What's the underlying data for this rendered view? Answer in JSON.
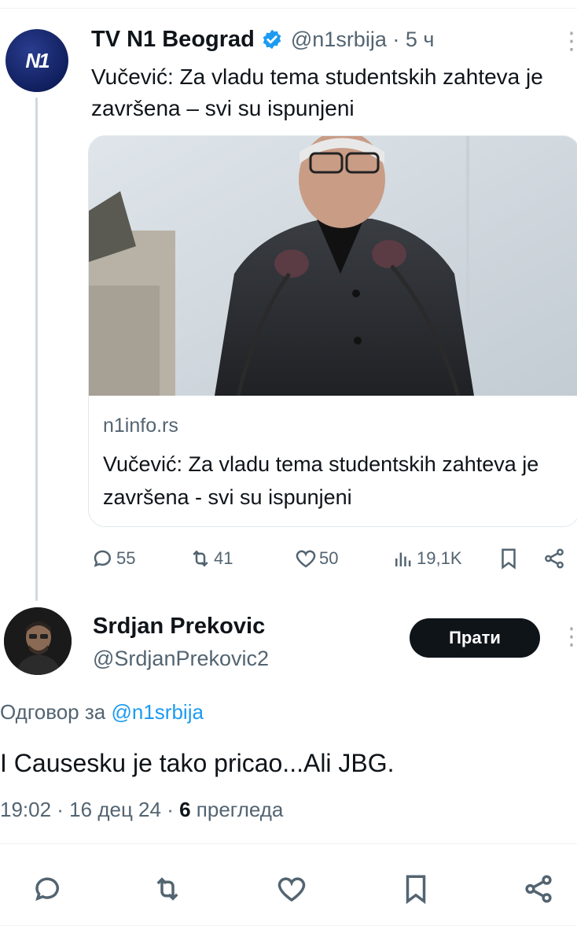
{
  "parent_tweet": {
    "author_name": "TV N1 Beograd",
    "handle_time": "@n1srbija · 5 ч",
    "text": "Vučević: Za vladu tema studentskih zahteva je završena – svi su ispunjeni",
    "avatar_logo": "N1",
    "card": {
      "domain": "n1info.rs",
      "title": "Vučević: Za vladu tema studentskih zahteva je završena - svi su ispunjeni"
    },
    "actions": {
      "replies": "55",
      "retweets": "41",
      "likes": "50",
      "views": "19,1K"
    }
  },
  "reply_tweet": {
    "author_name": "Srdjan Prekovic",
    "handle": "@SrdjanPrekovic2",
    "follow_label": "Прати",
    "reply_to_label": "Одговор за",
    "reply_to_mention": "@n1srbija",
    "text": "I Causesku je tako pricao...Ali JBG.",
    "time_date": "19:02 · 16 дец 24 · ",
    "views_count": "6",
    "views_label": " прегледа"
  },
  "icons": [
    "verified-badge-icon",
    "more-icon",
    "reply-icon",
    "retweet-icon",
    "like-icon",
    "views-icon",
    "bookmark-icon",
    "share-icon"
  ],
  "colors": {
    "accent": "#1d9bf0",
    "text": "#0f1419",
    "muted": "#536471",
    "follow_bg": "#0f1419"
  }
}
